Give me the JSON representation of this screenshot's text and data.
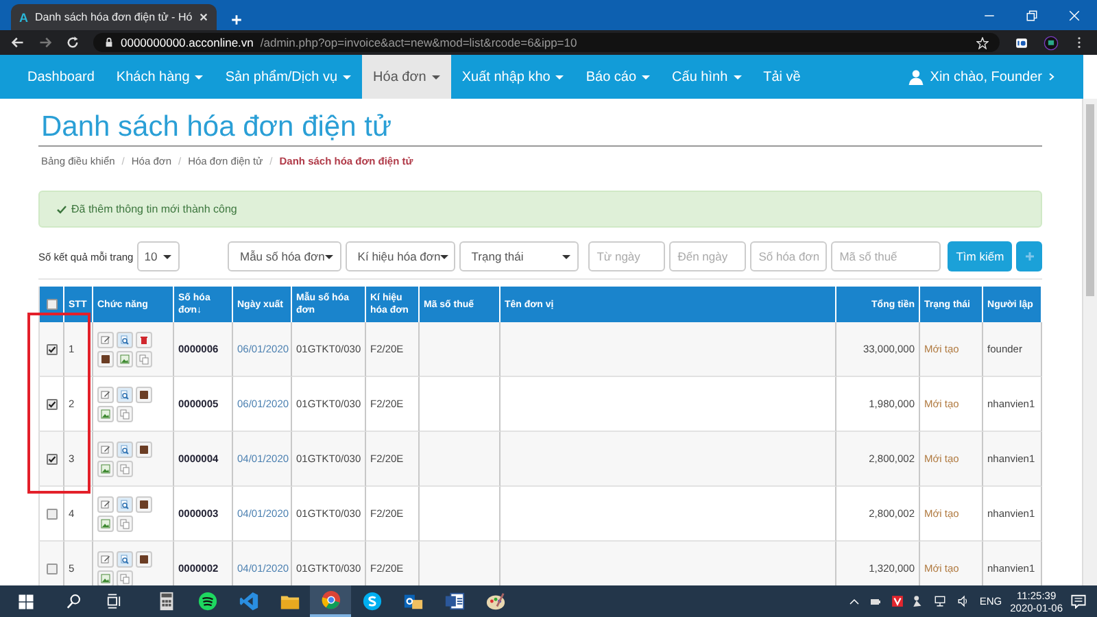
{
  "browser": {
    "tab": {
      "favicon": "A",
      "title": "Danh sách hóa đơn điện tử - Hó",
      "selected": true
    },
    "url_host": "0000000000.acconline.vn",
    "url_path": "/admin.php?op=invoice&act=new&mod=list&rcode=6&ipp=10"
  },
  "nav": {
    "items": [
      {
        "label": "Dashboard",
        "dropdown": false,
        "selected": false
      },
      {
        "label": "Khách hàng",
        "dropdown": true,
        "selected": false
      },
      {
        "label": "Sản phẩm/Dịch vụ",
        "dropdown": true,
        "selected": false
      },
      {
        "label": "Hóa đơn",
        "dropdown": true,
        "selected": true
      },
      {
        "label": "Xuất nhập kho",
        "dropdown": true,
        "selected": false
      },
      {
        "label": "Báo cáo",
        "dropdown": true,
        "selected": false
      },
      {
        "label": "Cấu hình",
        "dropdown": true,
        "selected": false
      },
      {
        "label": "Tải về",
        "dropdown": false,
        "selected": false
      }
    ],
    "user": "Xin chào, Founder"
  },
  "page": {
    "title": "Danh sách hóa đơn điện tử",
    "breadcrumb": [
      {
        "label": "Bảng điều khiển",
        "selected": false
      },
      {
        "separator": "/",
        "label": "Hóa đơn",
        "selected": false
      },
      {
        "separator": "/",
        "label": "Hóa đơn điện tử",
        "selected": false
      },
      {
        "separator": "/",
        "label": "Danh sách hóa đơn điện tử",
        "selected": true
      }
    ],
    "alert": "Đã thêm thông tin mới thành công"
  },
  "filters": {
    "page_size_label": "Số kết quả mỗi trang",
    "page_size": "10",
    "selects": [
      "Mẫu số hóa đơn",
      "Kí hiệu hóa đơn",
      "Trạng thái"
    ],
    "inputs": [
      {
        "placeholder": "Từ ngày"
      },
      {
        "placeholder": "Đến ngày"
      },
      {
        "placeholder": "Số hóa đơn"
      },
      {
        "placeholder": "Mã số thuế"
      }
    ],
    "search_button": "Tìm kiếm"
  },
  "table": {
    "header_checkbox": {
      "checked": false
    },
    "columns": [
      "STT",
      "Chức năng",
      "Số hóa đơn↓",
      "Ngày xuất",
      "Mẫu số hóa đơn",
      "Kí hiệu hóa đơn",
      "Mã số thuế",
      "Tên đơn vị",
      "Tổng tiền",
      "Trạng thái",
      "Người lập"
    ],
    "rows": [
      {
        "checked": true,
        "highlighted": true,
        "stt": "1",
        "actions": [
          {
            "kind": "edit"
          },
          {
            "kind": "view"
          },
          {
            "kind": "delete"
          },
          {
            "kind": "sign"
          },
          {
            "kind": "image"
          },
          {
            "kind": "copy"
          }
        ],
        "invoice_no": "0000006",
        "date": "06/01/2020",
        "form": "01GTKT0/030",
        "symbol": "F2/20E",
        "total": "33,000,000",
        "status": "Mới tạo",
        "creator": "founder"
      },
      {
        "checked": true,
        "highlighted": true,
        "stt": "2",
        "actions": [
          {
            "kind": "edit"
          },
          {
            "kind": "view"
          },
          {
            "kind": "sign"
          },
          {
            "kind": "image"
          },
          {
            "kind": "copy"
          }
        ],
        "invoice_no": "0000005",
        "date": "06/01/2020",
        "form": "01GTKT0/030",
        "symbol": "F2/20E",
        "total": "1,980,000",
        "status": "Mới tạo",
        "creator": "nhanvien1"
      },
      {
        "checked": true,
        "highlighted": true,
        "stt": "3",
        "actions": [
          {
            "kind": "edit"
          },
          {
            "kind": "view"
          },
          {
            "kind": "sign"
          },
          {
            "kind": "image"
          },
          {
            "kind": "copy"
          }
        ],
        "invoice_no": "0000004",
        "date": "04/01/2020",
        "form": "01GTKT0/030",
        "symbol": "F2/20E",
        "total": "2,800,002",
        "status": "Mới tạo",
        "creator": "nhanvien1"
      },
      {
        "checked": false,
        "highlighted": false,
        "stt": "4",
        "actions": [
          {
            "kind": "edit"
          },
          {
            "kind": "view"
          },
          {
            "kind": "sign"
          },
          {
            "kind": "image"
          },
          {
            "kind": "copy"
          }
        ],
        "invoice_no": "0000003",
        "date": "04/01/2020",
        "form": "01GTKT0/030",
        "symbol": "F2/20E",
        "total": "2,800,002",
        "status": "Mới tạo",
        "creator": "nhanvien1"
      },
      {
        "checked": false,
        "highlighted": false,
        "stt": "5",
        "actions": [
          {
            "kind": "edit"
          },
          {
            "kind": "view"
          },
          {
            "kind": "sign"
          },
          {
            "kind": "image"
          },
          {
            "kind": "copy"
          }
        ],
        "invoice_no": "0000002",
        "date": "04/01/2020",
        "form": "01GTKT0/030",
        "symbol": "F2/20E",
        "total": "1,320,000",
        "status": "Mới tạo",
        "creator": "nhanvien1"
      }
    ]
  },
  "taskbar": {
    "apps": [
      {
        "kind": "calculator",
        "selected": false
      },
      {
        "kind": "music",
        "selected": false
      },
      {
        "kind": "code",
        "selected": false
      },
      {
        "kind": "folder",
        "selected": false
      },
      {
        "kind": "browser",
        "selected": true
      },
      {
        "kind": "chat",
        "selected": false
      },
      {
        "kind": "mail",
        "selected": false
      },
      {
        "kind": "document",
        "selected": false
      },
      {
        "kind": "paint",
        "selected": false
      }
    ],
    "language": "ENG",
    "time": "11:25:39",
    "date": "2020-01-06"
  }
}
